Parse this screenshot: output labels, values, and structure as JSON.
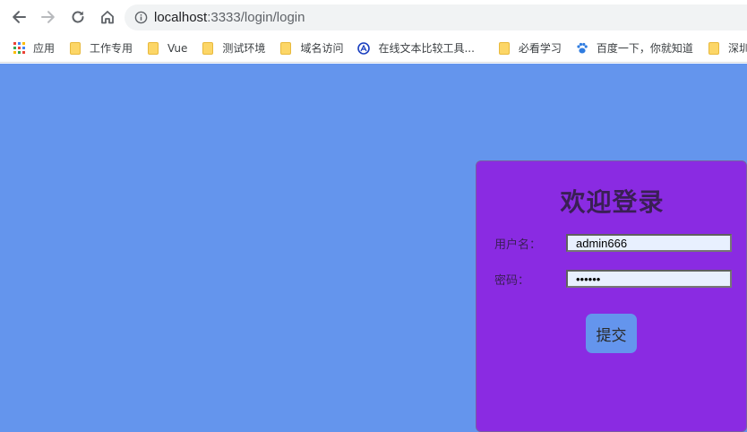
{
  "browser": {
    "url_host": "localhost",
    "url_rest": ":3333/login/login",
    "bookmarks": [
      {
        "label": "应用",
        "icon": "apps-icon"
      },
      {
        "label": "工作专用",
        "icon": "folder-icon"
      },
      {
        "label": "Vue",
        "icon": "folder-icon"
      },
      {
        "label": "测试环境",
        "icon": "folder-icon"
      },
      {
        "label": "域名访问",
        "icon": "folder-icon"
      },
      {
        "label": "在线文本比较工具...",
        "icon": "diff-tool-icon"
      },
      {
        "label": "必看学习",
        "icon": "folder-icon"
      },
      {
        "label": "百度一下，你就知道",
        "icon": "baidu-paw-icon"
      },
      {
        "label": "深圳",
        "icon": "folder-icon"
      }
    ]
  },
  "login": {
    "title": "欢迎登录",
    "username_label": "用户名：",
    "username_value": "admin666",
    "password_label": "密码：",
    "password_value": "666666",
    "submit_label": "提交"
  },
  "colors": {
    "page_background": "#6495ed",
    "card_background": "#8a2be2",
    "button_background": "#6495ed"
  }
}
